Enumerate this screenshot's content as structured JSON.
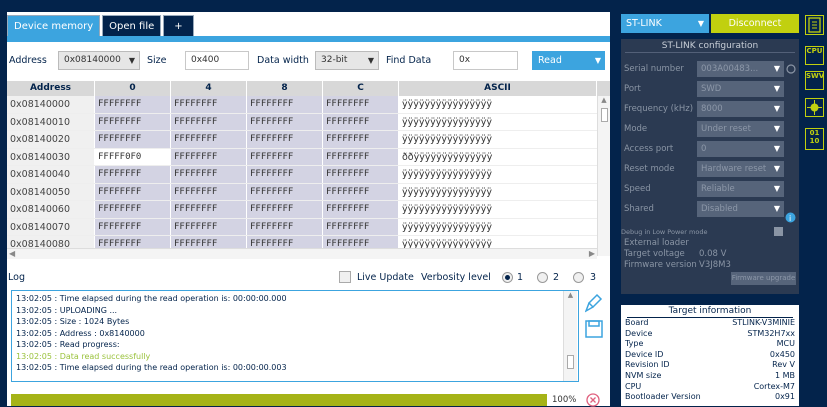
{
  "tabs": {
    "device_memory": "Device memory",
    "open_file": "Open file",
    "add": "+"
  },
  "toolbar": {
    "address_label": "Address",
    "address_value": "0x08140000",
    "size_label": "Size",
    "size_value": "0x400",
    "width_label": "Data width",
    "width_value": "32-bit",
    "find_label": "Find Data",
    "find_value": "0x",
    "read_label": "Read"
  },
  "table": {
    "headers": [
      "Address",
      "0",
      "4",
      "8",
      "C",
      "ASCII"
    ],
    "rows": [
      {
        "addr": "0x08140000",
        "c0": "FFFFFFFF",
        "c4": "FFFFFFFF",
        "c8": "FFFFFFFF",
        "cc": "FFFFFFFF",
        "ascii": "ÿÿÿÿÿÿÿÿÿÿÿÿÿÿÿÿ"
      },
      {
        "addr": "0x08140010",
        "c0": "FFFFFFFF",
        "c4": "FFFFFFFF",
        "c8": "FFFFFFFF",
        "cc": "FFFFFFFF",
        "ascii": "ÿÿÿÿÿÿÿÿÿÿÿÿÿÿÿÿ"
      },
      {
        "addr": "0x08140020",
        "c0": "FFFFFFFF",
        "c4": "FFFFFFFF",
        "c8": "FFFFFFFF",
        "cc": "FFFFFFFF",
        "ascii": "ÿÿÿÿÿÿÿÿÿÿÿÿÿÿÿÿ"
      },
      {
        "addr": "0x08140030",
        "c0": "FFFFF0F0",
        "c4": "FFFFFFFF",
        "c8": "FFFFFFFF",
        "cc": "FFFFFFFF",
        "ascii": "ððÿÿÿÿÿÿÿÿÿÿÿÿÿÿ"
      },
      {
        "addr": "0x08140040",
        "c0": "FFFFFFFF",
        "c4": "FFFFFFFF",
        "c8": "FFFFFFFF",
        "cc": "FFFFFFFF",
        "ascii": "ÿÿÿÿÿÿÿÿÿÿÿÿÿÿÿÿ"
      },
      {
        "addr": "0x08140050",
        "c0": "FFFFFFFF",
        "c4": "FFFFFFFF",
        "c8": "FFFFFFFF",
        "cc": "FFFFFFFF",
        "ascii": "ÿÿÿÿÿÿÿÿÿÿÿÿÿÿÿÿ"
      },
      {
        "addr": "0x08140060",
        "c0": "FFFFFFFF",
        "c4": "FFFFFFFF",
        "c8": "FFFFFFFF",
        "cc": "FFFFFFFF",
        "ascii": "ÿÿÿÿÿÿÿÿÿÿÿÿÿÿÿÿ"
      },
      {
        "addr": "0x08140070",
        "c0": "FFFFFFFF",
        "c4": "FFFFFFFF",
        "c8": "FFFFFFFF",
        "cc": "FFFFFFFF",
        "ascii": "ÿÿÿÿÿÿÿÿÿÿÿÿÿÿÿÿ"
      },
      {
        "addr": "0x08140080",
        "c0": "FFFFFFFF",
        "c4": "FFFFFFFF",
        "c8": "FFFFFFFF",
        "cc": "FFFFFFFF",
        "ascii": "ÿÿÿÿÿÿÿÿÿÿÿÿÿÿÿÿ"
      }
    ]
  },
  "log": {
    "label": "Log",
    "live_update": "Live Update",
    "verbosity_label": "Verbosity level",
    "levels": [
      "1",
      "2",
      "3"
    ],
    "lines": [
      {
        "text": "13:02:05 : Time elapsed during the read operation is: 00:00:00.000",
        "success": false
      },
      {
        "text": "13:02:05 : UPLOADING ...",
        "success": false
      },
      {
        "text": "13:02:05 :  Size        : 1024 Bytes",
        "success": false
      },
      {
        "text": "13:02:05 :  Address     : 0x8140000",
        "success": false
      },
      {
        "text": "13:02:05 : Read progress:",
        "success": false
      },
      {
        "text": "13:02:05 : Data read successfully",
        "success": true
      },
      {
        "text": "13:02:05 : Time elapsed during the read operation is: 00:00:00.003",
        "success": false
      }
    ]
  },
  "progress": {
    "value": 1.0,
    "label": "100%"
  },
  "probe": {
    "name": "ST-LINK",
    "connect_label": "Disconnect"
  },
  "config": {
    "title": "ST-LINK configuration",
    "rows": [
      {
        "key": "Serial number",
        "value": "003A00483..."
      },
      {
        "key": "Port",
        "value": "SWD"
      },
      {
        "key": "Frequency (kHz)",
        "value": "8000"
      },
      {
        "key": "Mode",
        "value": "Under reset"
      },
      {
        "key": "Access port",
        "value": "0"
      },
      {
        "key": "Reset mode",
        "value": "Hardware reset"
      },
      {
        "key": "Speed",
        "value": "Reliable"
      },
      {
        "key": "Shared",
        "value": "Disabled"
      }
    ],
    "debug_lp": "Debug in Low Power mode",
    "external_loader": "External loader",
    "target_voltage_label": "Target voltage",
    "target_voltage": "0.08 V",
    "firmware_label": "Firmware version",
    "firmware": "V3J8M3",
    "fw_upgrade": "Firmware upgrade"
  },
  "target": {
    "title": "Target information",
    "rows": [
      {
        "key": "Board",
        "value": "STLINK-V3MINIE"
      },
      {
        "key": "Device",
        "value": "STM32H7xx"
      },
      {
        "key": "Type",
        "value": "MCU"
      },
      {
        "key": "Device ID",
        "value": "0x450"
      },
      {
        "key": "Revision ID",
        "value": "Rev V"
      },
      {
        "key": "NVM size",
        "value": "1 MB"
      },
      {
        "key": "CPU",
        "value": "Cortex-M7"
      },
      {
        "key": "Bootloader Version",
        "value": "0x91"
      }
    ]
  },
  "sidebar": {
    "cpu": "CPU",
    "swv": "SWV",
    "bin": "01 10"
  }
}
